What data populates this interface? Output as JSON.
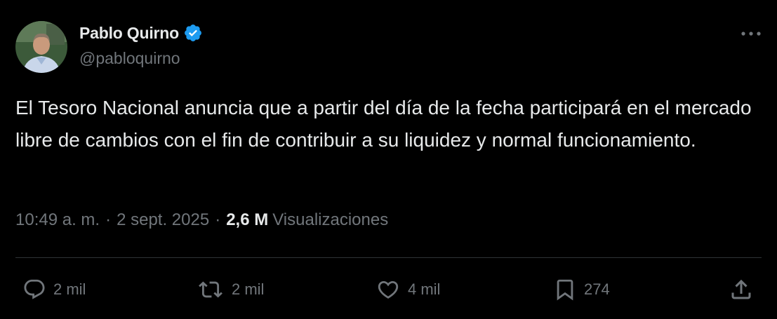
{
  "author": {
    "display_name": "Pablo Quirno",
    "handle": "@pabloquirno",
    "verified": true
  },
  "tweet": {
    "text": "El Tesoro Nacional anuncia que a partir del día de la fecha participará en el mercado libre de cambios con el fin de contribuir a su liquidez y normal funcionamiento.",
    "time": "10:49 a. m.",
    "date": "2 sept. 2025",
    "separator": "·",
    "views_count": "2,6 M",
    "views_label": "Visualizaciones"
  },
  "actions": {
    "replies": "2 mil",
    "reposts": "2 mil",
    "likes": "4 mil",
    "bookmarks": "274"
  },
  "colors": {
    "background": "#000000",
    "primary_text": "#e7e9ea",
    "secondary_text": "#71767b",
    "divider": "#2f3336",
    "verified_badge": "#1d9bf0"
  }
}
